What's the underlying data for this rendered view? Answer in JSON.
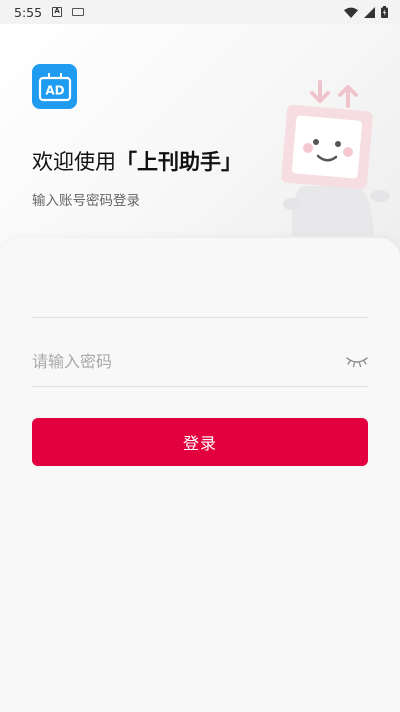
{
  "status_bar": {
    "time": "5:55",
    "icons": [
      "a-notification-icon",
      "keyboard-icon",
      "wifi-icon",
      "signal-icon",
      "battery-icon"
    ]
  },
  "header": {
    "welcome_prefix": "欢迎使用",
    "app_name": "「上刊助手」",
    "subtitle": "输入账号密码登录",
    "logo_text": "AD"
  },
  "form": {
    "account_value": "",
    "account_placeholder": "",
    "password_placeholder": "请输入密码",
    "password_toggle_icon": "eye-closed-icon",
    "login_label": "登录"
  },
  "colors": {
    "accent": "#e3003f",
    "logo_bg": "#1f9cf0"
  }
}
